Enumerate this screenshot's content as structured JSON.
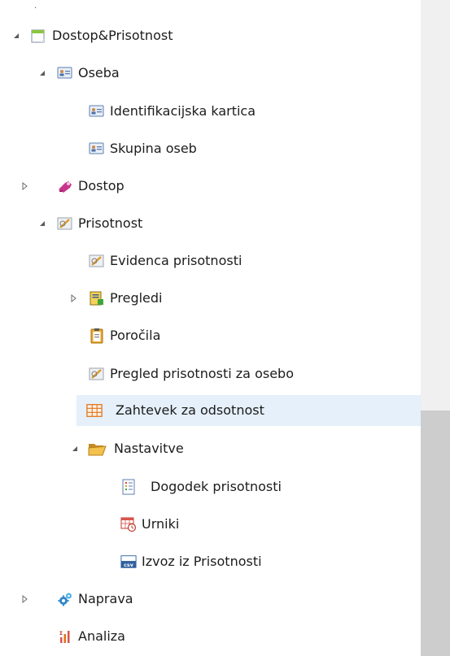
{
  "tree": {
    "nodes": [
      {
        "id": "dostop-prisotnost",
        "label": "Dostop&Prisotnost",
        "icon": "calendar-icon",
        "state": "expanded"
      },
      {
        "id": "oseba",
        "label": "Oseba",
        "icon": "id-card-icon",
        "state": "expanded"
      },
      {
        "id": "identifikacijska-kartica",
        "label": "Identifikacijska kartica",
        "icon": "id-card-icon",
        "state": "leaf"
      },
      {
        "id": "skupina-oseb",
        "label": "Skupina oseb",
        "icon": "id-card-icon",
        "state": "leaf"
      },
      {
        "id": "dostop",
        "label": "Dostop",
        "icon": "key-icon",
        "state": "collapsed"
      },
      {
        "id": "prisotnost",
        "label": "Prisotnost",
        "icon": "attendance-icon",
        "state": "expanded"
      },
      {
        "id": "evidenca-prisotnosti",
        "label": "Evidenca prisotnosti",
        "icon": "attendance-icon",
        "state": "leaf"
      },
      {
        "id": "pregledi",
        "label": "Pregledi",
        "icon": "report-view-icon",
        "state": "collapsed"
      },
      {
        "id": "porocila",
        "label": "Poročila",
        "icon": "clipboard-icon",
        "state": "leaf"
      },
      {
        "id": "pregled-prisotnosti-za-osebo",
        "label": "Pregled prisotnosti za osebo",
        "icon": "attendance-icon",
        "state": "leaf"
      },
      {
        "id": "zahtevek-za-odsotnost",
        "label": "Zahtevek za odsotnost",
        "icon": "grid-table-icon",
        "state": "leaf",
        "selected": true
      },
      {
        "id": "nastavitve",
        "label": "Nastavitve",
        "icon": "folder-open-icon",
        "state": "expanded"
      },
      {
        "id": "dogodek-prisotnosti",
        "label": "Dogodek prisotnosti",
        "icon": "event-list-icon",
        "state": "leaf"
      },
      {
        "id": "urniki",
        "label": "Urniki",
        "icon": "schedule-icon",
        "state": "leaf"
      },
      {
        "id": "izvoz-iz-prisotnosti",
        "label": "Izvoz iz Prisotnosti",
        "icon": "csv-icon",
        "state": "leaf"
      },
      {
        "id": "naprava",
        "label": "Naprava",
        "icon": "gears-icon",
        "state": "collapsed"
      },
      {
        "id": "analiza",
        "label": "Analiza",
        "icon": "analysis-chart-icon",
        "state": "leaf"
      }
    ]
  },
  "colors": {
    "selected_row": "#e5f0fa",
    "text": "#1c1c1c",
    "scrollbar_track": "#f0f0f0",
    "scrollbar_thumb": "#cdcdcd"
  }
}
